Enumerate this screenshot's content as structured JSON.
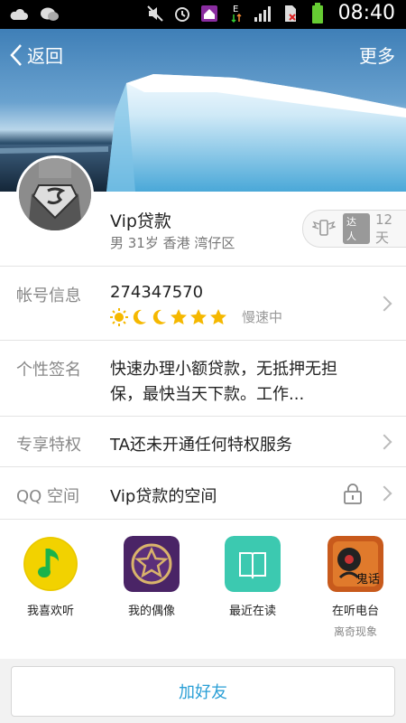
{
  "status_bar": {
    "time": "08:40",
    "icons": [
      "cloud-icon",
      "wechat-icon",
      "mute-icon",
      "alarm-icon",
      "home-icon",
      "data-e-icon",
      "signal-icon",
      "no-sim-icon",
      "battery-icon"
    ]
  },
  "header": {
    "back_label": "返回",
    "more_label": "更多"
  },
  "profile": {
    "name": "Vip贷款",
    "meta": "男 31岁 香港 湾仔区",
    "badge_label": "达人",
    "badge_days": "12天"
  },
  "rows": {
    "account": {
      "label": "帐号信息",
      "number": "274347570",
      "speed": "慢速中"
    },
    "signature": {
      "label": "个性签名",
      "line1": "快速办理小额贷款，无抵押无担",
      "line2": "保，最快当天下款。工作..."
    },
    "privilege": {
      "label": "专享特权",
      "value": "TA还未开通任何特权服务"
    },
    "qzone": {
      "label": "QQ 空间",
      "value": "Vip贷款的空间"
    }
  },
  "apps": [
    {
      "label": "我喜欢听",
      "sub": ""
    },
    {
      "label": "我的偶像",
      "sub": ""
    },
    {
      "label": "最近在读",
      "sub": ""
    },
    {
      "label": "在听电台",
      "sub": "离奇现象",
      "ico_text": "鬼话"
    }
  ],
  "add_friend_label": "加好友",
  "colors": {
    "accent": "#2a9fd6",
    "music_yellow": "#f2d200",
    "idol_purple": "#5b2f7a",
    "read_teal": "#3cc9b0"
  }
}
